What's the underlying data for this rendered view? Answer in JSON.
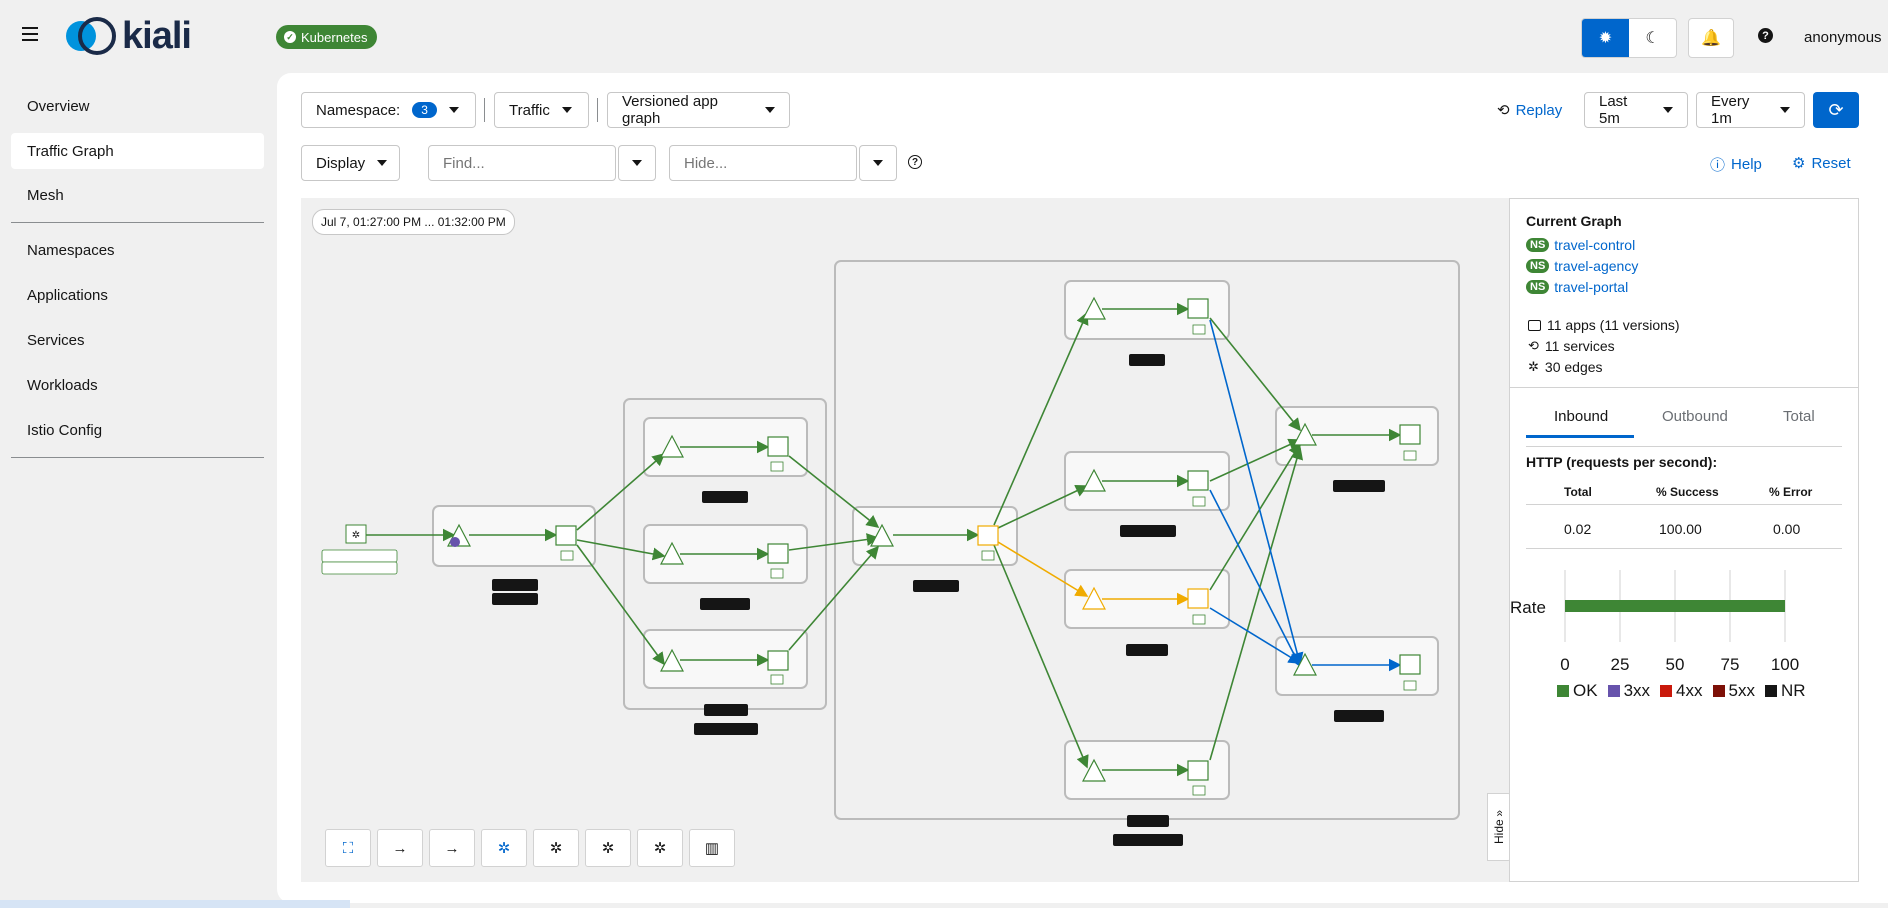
{
  "app": {
    "brand": "kiali",
    "cluster_badge": "Kubernetes",
    "user": "anonymous"
  },
  "sidebar": {
    "items": [
      {
        "label": "Overview"
      },
      {
        "label": "Traffic Graph"
      },
      {
        "label": "Mesh"
      },
      {
        "label": "Namespaces"
      },
      {
        "label": "Applications"
      },
      {
        "label": "Services"
      },
      {
        "label": "Workloads"
      },
      {
        "label": "Istio Config"
      }
    ],
    "active": "Traffic Graph"
  },
  "toolbar": {
    "namespace_label": "Namespace:",
    "namespace_count": "3",
    "traffic_label": "Traffic",
    "graph_type": "Versioned app graph",
    "replay_label": "Replay",
    "duration": "Last 5m",
    "refresh": "Every 1m",
    "display_label": "Display",
    "find_placeholder": "Find...",
    "hide_placeholder": "Hide...",
    "help_label": "Help",
    "reset_label": "Reset"
  },
  "graph": {
    "time_range": "Jul 7, 01:27:00 PM ... 01:32:00 PM",
    "hide_label": "Hide",
    "colors": {
      "ok": "#3e8635",
      "warn": "#f0ab00",
      "tcp": "#0066cc",
      "box": "#bbbbbb"
    }
  },
  "panel": {
    "title": "Current Graph",
    "namespaces": [
      "travel-control",
      "travel-agency",
      "travel-portal"
    ],
    "ns_badge": "NS",
    "stats": {
      "apps": "11 apps (11 versions)",
      "services": "11 services",
      "edges": "30 edges"
    },
    "tabs": [
      "Inbound",
      "Outbound",
      "Total"
    ],
    "http_title": "HTTP (requests per second):",
    "table": {
      "headers": [
        "Total",
        "% Success",
        "% Error"
      ],
      "values": [
        "0.02",
        "100.00",
        "0.00"
      ]
    }
  },
  "chart_data": {
    "type": "bar",
    "categories": [
      "Rate"
    ],
    "series": [
      {
        "name": "OK",
        "values": [
          100
        ],
        "color": "#3e8635"
      },
      {
        "name": "3xx",
        "values": [
          0
        ],
        "color": "#6753ac"
      },
      {
        "name": "4xx",
        "values": [
          0
        ],
        "color": "#c9190b"
      },
      {
        "name": "5xx",
        "values": [
          0
        ],
        "color": "#7d1007"
      },
      {
        "name": "NR",
        "values": [
          0
        ],
        "color": "#151515"
      }
    ],
    "xlim": [
      0,
      100
    ],
    "xticks": [
      "0",
      "25",
      "50",
      "75",
      "100"
    ],
    "orientation": "horizontal",
    "stacked": true
  }
}
